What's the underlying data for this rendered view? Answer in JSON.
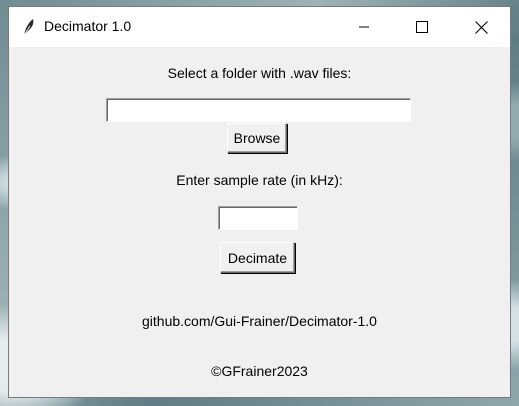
{
  "window": {
    "title": "Decimator 1.0",
    "icon": "feather-icon",
    "controls": {
      "minimize": "minimize-icon",
      "maximize": "maximize-icon",
      "close": "close-icon"
    }
  },
  "form": {
    "folder_label": "Select a folder with .wav files:",
    "folder_value": "",
    "browse_label": "Browse",
    "rate_label": "Enter sample rate (in kHz):",
    "rate_value": "",
    "decimate_label": "Decimate"
  },
  "footer": {
    "link_text": "github.com/Gui-Frainer/Decimator-1.0",
    "copyright": "©GFrainer2023"
  },
  "colors": {
    "window_bg": "#f0f0f0",
    "titlebar_bg": "#ffffff",
    "text": "#000000"
  }
}
